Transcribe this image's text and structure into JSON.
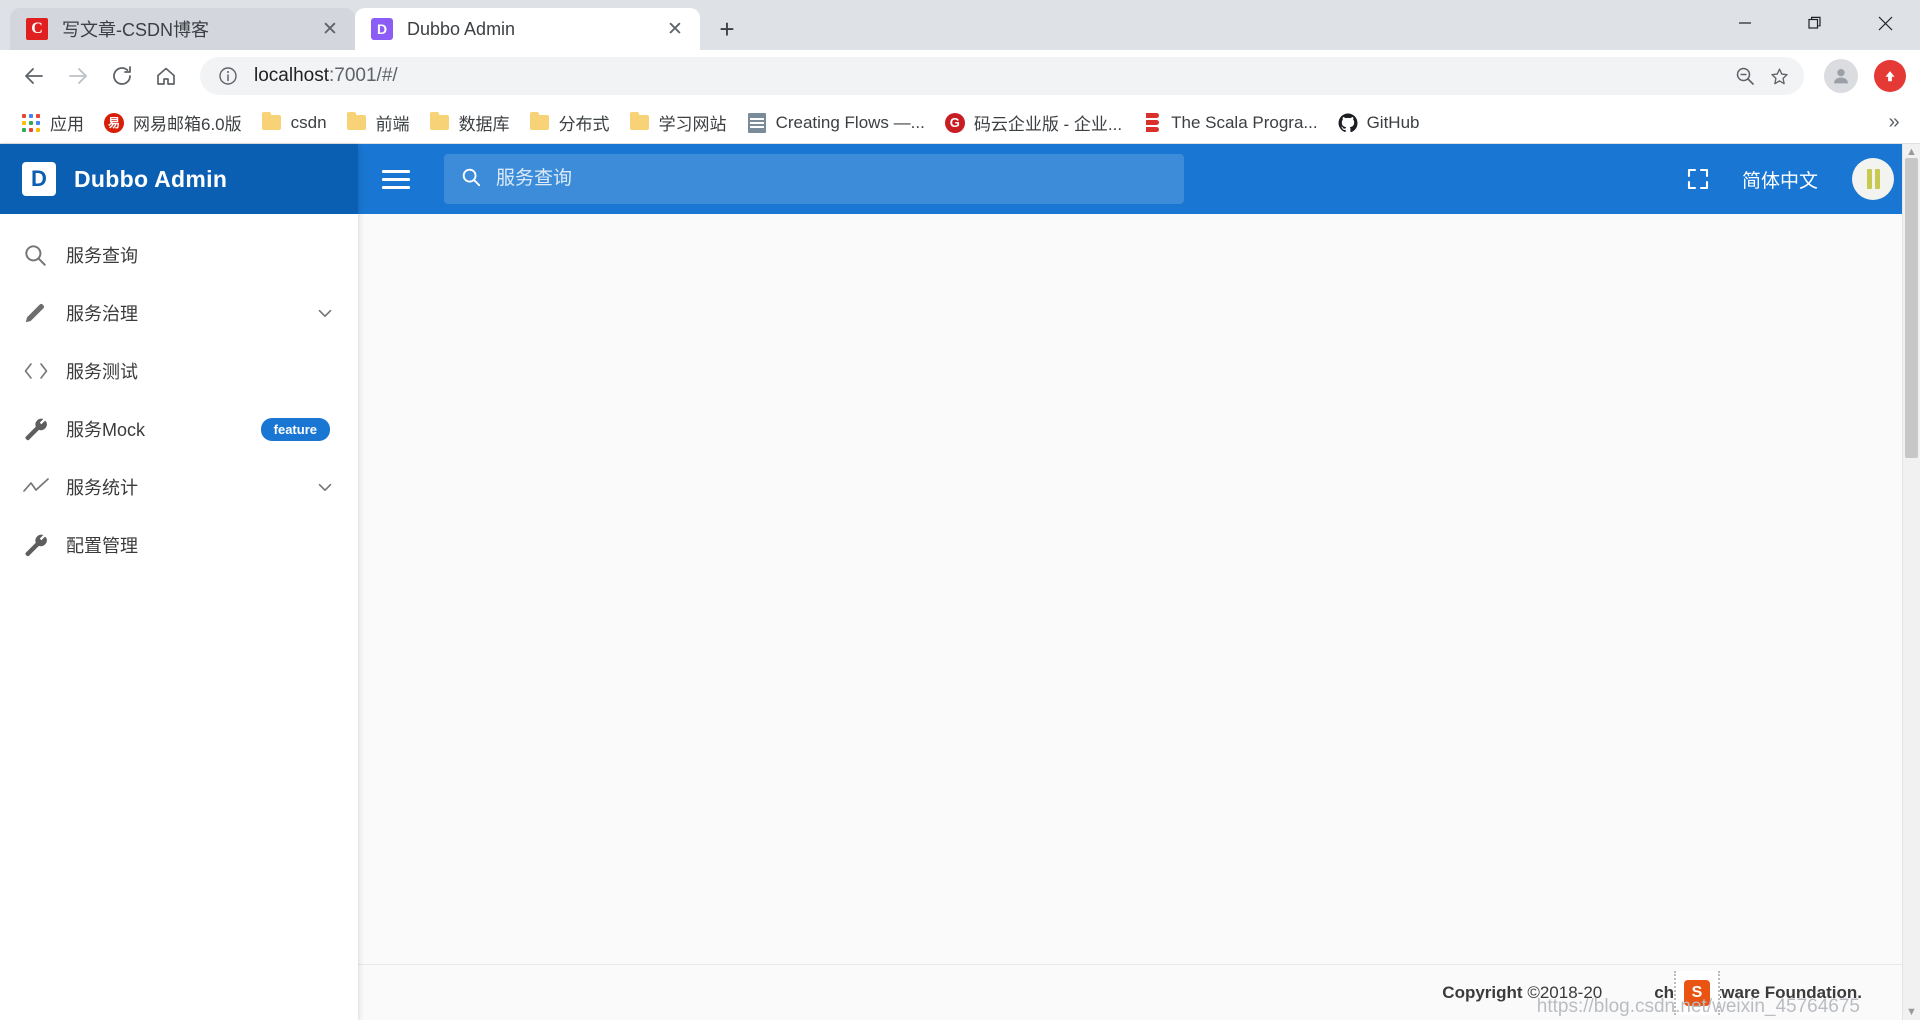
{
  "browser": {
    "tabs": [
      {
        "title": "写文章-CSDN博客",
        "favicon": "csdn-icon",
        "favicon_char": "C",
        "active": false
      },
      {
        "title": "Dubbo Admin",
        "favicon": "dubbo-icon",
        "favicon_char": "D",
        "active": true
      }
    ],
    "new_tab_label": "+",
    "window_controls": {
      "minimize": "–",
      "maximize": "❐",
      "close": "✕"
    },
    "toolbar": {
      "back_label": "←",
      "forward_label": "→",
      "reload_label": "↻",
      "home_label": "⌂",
      "site_info_label": "ⓘ",
      "url": "localhost",
      "url_path": ":7001/#/",
      "zoom_label": "zoom-out-icon",
      "bookmark_star_label": "☆",
      "profile_label": "profile-avatar",
      "update_label": "⬆"
    },
    "bookmarks": [
      {
        "label": "应用",
        "icon": "apps-grid-icon"
      },
      {
        "label": "网易邮箱6.0版",
        "icon": "netease-mail-icon",
        "icon_char": "易"
      },
      {
        "label": "csdn",
        "icon": "folder-icon"
      },
      {
        "label": "前端",
        "icon": "folder-icon"
      },
      {
        "label": "数据库",
        "icon": "folder-icon"
      },
      {
        "label": "分布式",
        "icon": "folder-icon"
      },
      {
        "label": "学习网站",
        "icon": "folder-icon"
      },
      {
        "label": "Creating Flows —...",
        "icon": "document-icon"
      },
      {
        "label": "码云企业版 - 企业...",
        "icon": "gitee-icon",
        "icon_char": "G"
      },
      {
        "label": "The Scala Progra...",
        "icon": "scala-icon"
      },
      {
        "label": "GitHub",
        "icon": "github-icon"
      }
    ],
    "bookmarks_overflow_label": "»"
  },
  "app": {
    "brand": {
      "logo_char": "D",
      "title": "Dubbo Admin"
    },
    "sidebar": {
      "items": [
        {
          "label": "服务查询",
          "icon": "search-icon",
          "badge": null,
          "chevron": false
        },
        {
          "label": "服务治理",
          "icon": "pencil-icon",
          "badge": null,
          "chevron": true
        },
        {
          "label": "服务测试",
          "icon": "code-brackets-icon",
          "badge": null,
          "chevron": false
        },
        {
          "label": "服务Mock",
          "icon": "wrench-icon",
          "badge": "feature",
          "chevron": false
        },
        {
          "label": "服务统计",
          "icon": "trending-line-icon",
          "badge": null,
          "chevron": true
        },
        {
          "label": "配置管理",
          "icon": "wrench-icon",
          "badge": null,
          "chevron": false
        }
      ]
    },
    "appbar": {
      "menu_toggle_label": "hamburger-icon",
      "search": {
        "placeholder": "服务查询",
        "value": ""
      },
      "fullscreen_label": "fullscreen-icon",
      "language_label": "简体中文",
      "avatar_label": "user-avatar"
    },
    "footer": {
      "copyright_prefix": "Copyright",
      "copyright_body": "©2018-20",
      "copyright_suffix": "che Software Foundation.",
      "watermark": "https://blog.csdn.net/weixin_45764675",
      "watermark_badge_char": "S"
    }
  },
  "colors": {
    "brand_dark": "#0a5fb3",
    "brand": "#1976d2",
    "badge": "#1976d2",
    "page_bg": "#fafafa",
    "chrome_bg": "#dee1e6"
  }
}
